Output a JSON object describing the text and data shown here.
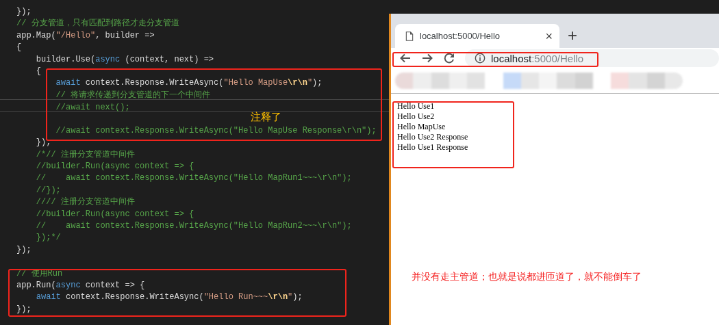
{
  "editor": {
    "lines": [
      {
        "current": false,
        "segments": [
          {
            "kind": "plain",
            "text": "});"
          }
        ]
      },
      {
        "current": false,
        "segments": [
          {
            "kind": "comment",
            "text": "// 分支管道，只有匹配到路径才走分支管道"
          }
        ]
      },
      {
        "current": false,
        "segments": [
          {
            "kind": "plain",
            "text": "app.Map("
          },
          {
            "kind": "string",
            "text": "\"/Hello\""
          },
          {
            "kind": "plain",
            "text": ", builder =>"
          }
        ]
      },
      {
        "current": false,
        "segments": [
          {
            "kind": "plain",
            "text": "{"
          }
        ]
      },
      {
        "current": false,
        "segments": [
          {
            "kind": "plain",
            "text": "    builder.Use("
          },
          {
            "kind": "keyword",
            "text": "async"
          },
          {
            "kind": "plain",
            "text": " (context, next) =>"
          }
        ]
      },
      {
        "current": false,
        "segments": [
          {
            "kind": "plain",
            "text": "    {"
          }
        ]
      },
      {
        "current": false,
        "segments": [
          {
            "kind": "keyword",
            "text": "        await"
          },
          {
            "kind": "plain",
            "text": " context.Response.WriteAsync("
          },
          {
            "kind": "string",
            "text": "\"Hello MapUse"
          },
          {
            "kind": "escape",
            "text": "\\r\\n"
          },
          {
            "kind": "string",
            "text": "\""
          },
          {
            "kind": "plain",
            "text": ");"
          }
        ]
      },
      {
        "current": false,
        "segments": [
          {
            "kind": "comment",
            "text": "        // 将请求传递到分支管道的下一个中间件"
          }
        ]
      },
      {
        "current": true,
        "segments": [
          {
            "kind": "comment",
            "text": "        //await next();"
          }
        ]
      },
      {
        "current": false
      },
      {
        "current": false,
        "segments": [
          {
            "kind": "comment",
            "text": "        //await context.Response.WriteAsync(\"Hello MapUse Response\\r\\n\");"
          }
        ]
      },
      {
        "current": false,
        "segments": [
          {
            "kind": "plain",
            "text": "    });"
          }
        ]
      },
      {
        "current": false,
        "segments": [
          {
            "kind": "comment",
            "text": "    /*// 注册分支管道中间件"
          }
        ]
      },
      {
        "current": false,
        "segments": [
          {
            "kind": "comment",
            "text": "    //builder.Run(async context => {"
          }
        ]
      },
      {
        "current": false,
        "segments": [
          {
            "kind": "comment",
            "text": "    //    await context.Response.WriteAsync(\"Hello MapRun1~~~\\r\\n\");"
          }
        ]
      },
      {
        "current": false,
        "segments": [
          {
            "kind": "comment",
            "text": "    //});"
          }
        ]
      },
      {
        "current": false,
        "segments": [
          {
            "kind": "comment",
            "text": "    //// 注册分支管道中间件"
          }
        ]
      },
      {
        "current": false,
        "segments": [
          {
            "kind": "comment",
            "text": "    //builder.Run(async context => {"
          }
        ]
      },
      {
        "current": false,
        "segments": [
          {
            "kind": "comment",
            "text": "    //    await context.Response.WriteAsync(\"Hello MapRun2~~~\\r\\n\");"
          }
        ]
      },
      {
        "current": false,
        "segments": [
          {
            "kind": "comment",
            "text": "    });*/"
          }
        ]
      },
      {
        "current": false,
        "segments": [
          {
            "kind": "plain",
            "text": "});"
          }
        ]
      },
      {
        "current": false
      },
      {
        "current": false,
        "segments": [
          {
            "kind": "comment",
            "text": "// 使用Run"
          }
        ]
      },
      {
        "current": false,
        "segments": [
          {
            "kind": "plain",
            "text": "app.Run("
          },
          {
            "kind": "keyword",
            "text": "async"
          },
          {
            "kind": "plain",
            "text": " context => {"
          }
        ]
      },
      {
        "current": false,
        "segments": [
          {
            "kind": "keyword",
            "text": "    await"
          },
          {
            "kind": "plain",
            "text": " context.Response.WriteAsync("
          },
          {
            "kind": "string",
            "text": "\"Hello Run~~~"
          },
          {
            "kind": "escape",
            "text": "\\r\\n"
          },
          {
            "kind": "string",
            "text": "\""
          },
          {
            "kind": "plain",
            "text": ");"
          }
        ]
      },
      {
        "current": false,
        "segments": [
          {
            "kind": "plain",
            "text": "});"
          }
        ]
      }
    ],
    "annotation": "注释了"
  },
  "browser": {
    "tab": {
      "title": "localhost:5000/Hello",
      "close": "×"
    },
    "new_tab": "+",
    "address": {
      "host": "localhost",
      "path": ":5000/Hello"
    },
    "output_lines": [
      "Hello Use1",
      "Hello Use2",
      "Hello MapUse",
      "Hello Use2 Response",
      "Hello Use1 Response"
    ],
    "note": "并没有走主管道；也就是说都进匝道了，就不能倒车了"
  }
}
